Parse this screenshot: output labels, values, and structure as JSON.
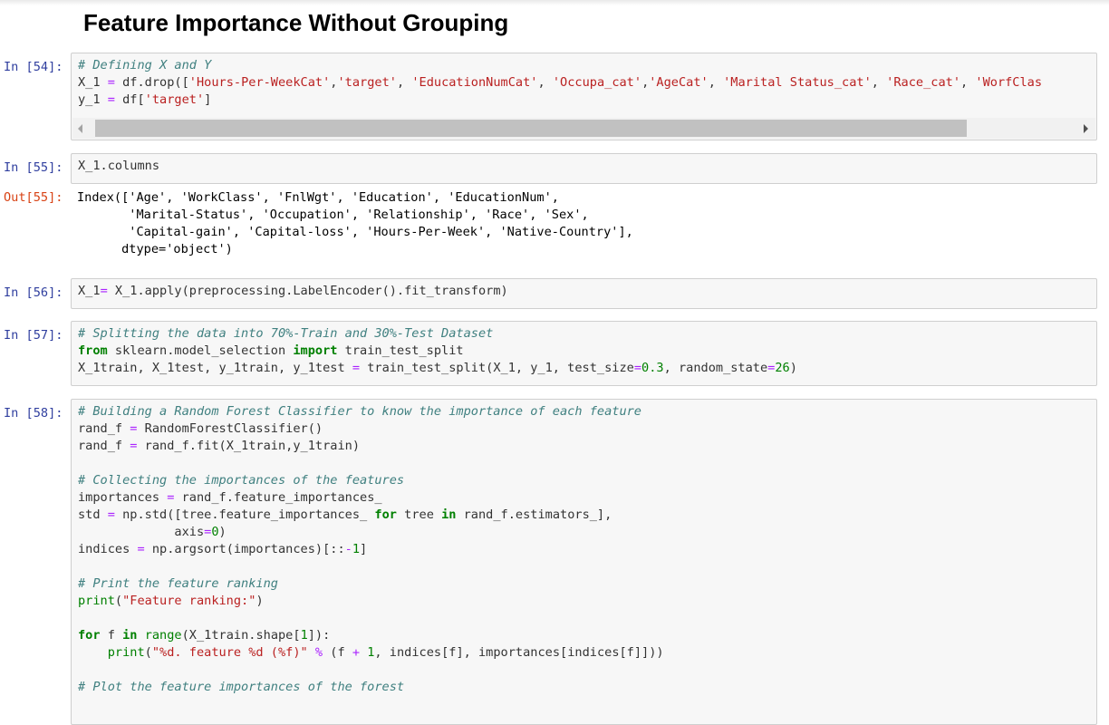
{
  "heading": "Feature Importance Without Grouping",
  "cells": [
    {
      "prompt": "In [54]:",
      "lines": [
        [
          [
            "cm",
            "# Defining X and Y"
          ]
        ],
        [
          [
            "",
            "X_1 "
          ],
          [
            "op",
            "="
          ],
          [
            "",
            " df.drop(["
          ],
          [
            "st",
            "'Hours-Per-WeekCat'"
          ],
          [
            "",
            ","
          ],
          [
            "st",
            "'target'"
          ],
          [
            "",
            ", "
          ],
          [
            "st",
            "'EducationNumCat'"
          ],
          [
            "",
            ", "
          ],
          [
            "st",
            "'Occupa_cat'"
          ],
          [
            "",
            ","
          ],
          [
            "st",
            "'AgeCat'"
          ],
          [
            "",
            ", "
          ],
          [
            "st",
            "'Marital Status_cat'"
          ],
          [
            "",
            ", "
          ],
          [
            "st",
            "'Race_cat'"
          ],
          [
            "",
            ", "
          ],
          [
            "st",
            "'WorfClas"
          ]
        ],
        [
          [
            "",
            "y_1 "
          ],
          [
            "op",
            "="
          ],
          [
            "",
            " df["
          ],
          [
            "st",
            "'target'"
          ],
          [
            "",
            "]"
          ]
        ]
      ],
      "has_scrollbar": true
    },
    {
      "prompt": "In [55]:",
      "lines": [
        [
          [
            "",
            "X_1.columns"
          ]
        ]
      ]
    },
    {
      "prompt": "In [56]:",
      "lines": [
        [
          [
            "",
            "X_1"
          ],
          [
            "op",
            "="
          ],
          [
            "",
            " X_1.apply(preprocessing.LabelEncoder().fit_transform)"
          ]
        ]
      ]
    },
    {
      "prompt": "In [57]:",
      "lines": [
        [
          [
            "cm",
            "# Splitting the data into 70%-Train and 30%-Test Dataset"
          ]
        ],
        [
          [
            "kw",
            "from"
          ],
          [
            "",
            " sklearn.model_selection "
          ],
          [
            "kw",
            "import"
          ],
          [
            "",
            " train_test_split"
          ]
        ],
        [
          [
            "",
            "X_1train, X_1test, y_1train, y_1test "
          ],
          [
            "op",
            "="
          ],
          [
            "",
            " train_test_split(X_1, y_1, test_size"
          ],
          [
            "op",
            "="
          ],
          [
            "nm",
            "0.3"
          ],
          [
            "",
            ", random_state"
          ],
          [
            "op",
            "="
          ],
          [
            "nm",
            "26"
          ],
          [
            "",
            ")"
          ]
        ]
      ]
    },
    {
      "prompt": "In [58]:",
      "lines": [
        [
          [
            "cm",
            "# Building a Random Forest Classifier to know the importance of each feature"
          ]
        ],
        [
          [
            "",
            "rand_f "
          ],
          [
            "op",
            "="
          ],
          [
            "",
            " RandomForestClassifier()"
          ]
        ],
        [
          [
            "",
            "rand_f "
          ],
          [
            "op",
            "="
          ],
          [
            "",
            " rand_f.fit(X_1train,y_1train)"
          ]
        ],
        [
          [
            "",
            ""
          ]
        ],
        [
          [
            "cm",
            "# Collecting the importances of the features"
          ]
        ],
        [
          [
            "",
            "importances "
          ],
          [
            "op",
            "="
          ],
          [
            "",
            " rand_f.feature_importances_"
          ]
        ],
        [
          [
            "",
            "std "
          ],
          [
            "op",
            "="
          ],
          [
            "",
            " np.std([tree.feature_importances_ "
          ],
          [
            "kw",
            "for"
          ],
          [
            "",
            " tree "
          ],
          [
            "kw",
            "in"
          ],
          [
            "",
            " rand_f.estimators_],"
          ]
        ],
        [
          [
            "",
            "             axis"
          ],
          [
            "op",
            "="
          ],
          [
            "nm",
            "0"
          ],
          [
            "",
            ")"
          ]
        ],
        [
          [
            "",
            "indices "
          ],
          [
            "op",
            "="
          ],
          [
            "",
            " np.argsort(importances)[::"
          ],
          [
            "op",
            "-"
          ],
          [
            "nm",
            "1"
          ],
          [
            "",
            "]"
          ]
        ],
        [
          [
            "",
            ""
          ]
        ],
        [
          [
            "cm",
            "# Print the feature ranking"
          ]
        ],
        [
          [
            "nb",
            "print"
          ],
          [
            "",
            "("
          ],
          [
            "st",
            "\"Feature ranking:\""
          ],
          [
            "",
            ")"
          ]
        ],
        [
          [
            "",
            ""
          ]
        ],
        [
          [
            "kw",
            "for"
          ],
          [
            "",
            " f "
          ],
          [
            "kw",
            "in"
          ],
          [
            "",
            " "
          ],
          [
            "nb",
            "range"
          ],
          [
            "",
            "(X_1train.shape["
          ],
          [
            "nm",
            "1"
          ],
          [
            "",
            "]):"
          ]
        ],
        [
          [
            "",
            "    "
          ],
          [
            "nb",
            "print"
          ],
          [
            "",
            "("
          ],
          [
            "st",
            "\"%d. feature %d (%f)\""
          ],
          [
            "",
            " "
          ],
          [
            "op",
            "%"
          ],
          [
            "",
            " (f "
          ],
          [
            "op",
            "+"
          ],
          [
            "",
            " "
          ],
          [
            "nm",
            "1"
          ],
          [
            "",
            ", indices[f], importances[indices[f]]))"
          ]
        ],
        [
          [
            "",
            ""
          ]
        ],
        [
          [
            "cm",
            "# Plot the feature importances of the forest"
          ]
        ]
      ]
    }
  ],
  "output_55": {
    "prompt": "Out[55]:",
    "lines": [
      "Index(['Age', 'WorkClass', 'FnlWgt', 'Education', 'EducationNum',",
      "       'Marital-Status', 'Occupation', 'Relationship', 'Race', 'Sex',",
      "       'Capital-gain', 'Capital-loss', 'Hours-Per-Week', 'Native-Country'],",
      "      dtype='object')"
    ]
  },
  "colors": {
    "in_prompt": "#303f9f",
    "out_prompt": "#d84315",
    "comment": "#408080",
    "string": "#ba2121",
    "keyword": "#008000",
    "operator": "#aa22ff"
  }
}
